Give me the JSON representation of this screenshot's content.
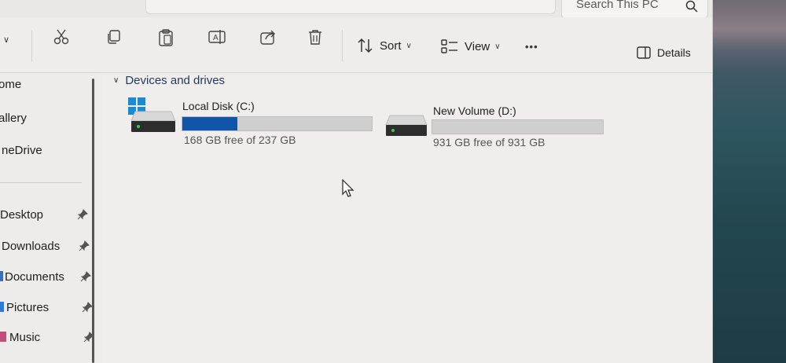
{
  "search": {
    "placeholder": "Search This PC"
  },
  "toolbar": {
    "sort_label": "Sort",
    "view_label": "View",
    "more_label": "•••",
    "details_label": "Details"
  },
  "sidebar": {
    "items": [
      {
        "label": "ome"
      },
      {
        "label": "allery"
      },
      {
        "label": "neDrive"
      },
      {
        "label": "Desktop"
      },
      {
        "label": "Downloads"
      },
      {
        "label": "Documents"
      },
      {
        "label": "Pictures"
      },
      {
        "label": "Music"
      }
    ]
  },
  "content": {
    "section_title": "Devices and drives",
    "drives": [
      {
        "name": "Local Disk (C:)",
        "free_text": "168 GB free of 237 GB",
        "used_fraction": 0.29
      },
      {
        "name": "New Volume (D:)",
        "free_text": "931 GB free of 931 GB",
        "used_fraction": 0.0
      }
    ]
  },
  "colors": {
    "accent": "#1155aa",
    "bar_bg": "#cfcfcf"
  },
  "icons": [
    "cut-icon",
    "copy-icon",
    "paste-icon",
    "rename-icon",
    "share-icon",
    "delete-icon",
    "sort-icon",
    "view-icon",
    "details-icon",
    "search-icon",
    "windows-logo-icon",
    "drive-icon",
    "pin-icon",
    "cursor-icon"
  ]
}
